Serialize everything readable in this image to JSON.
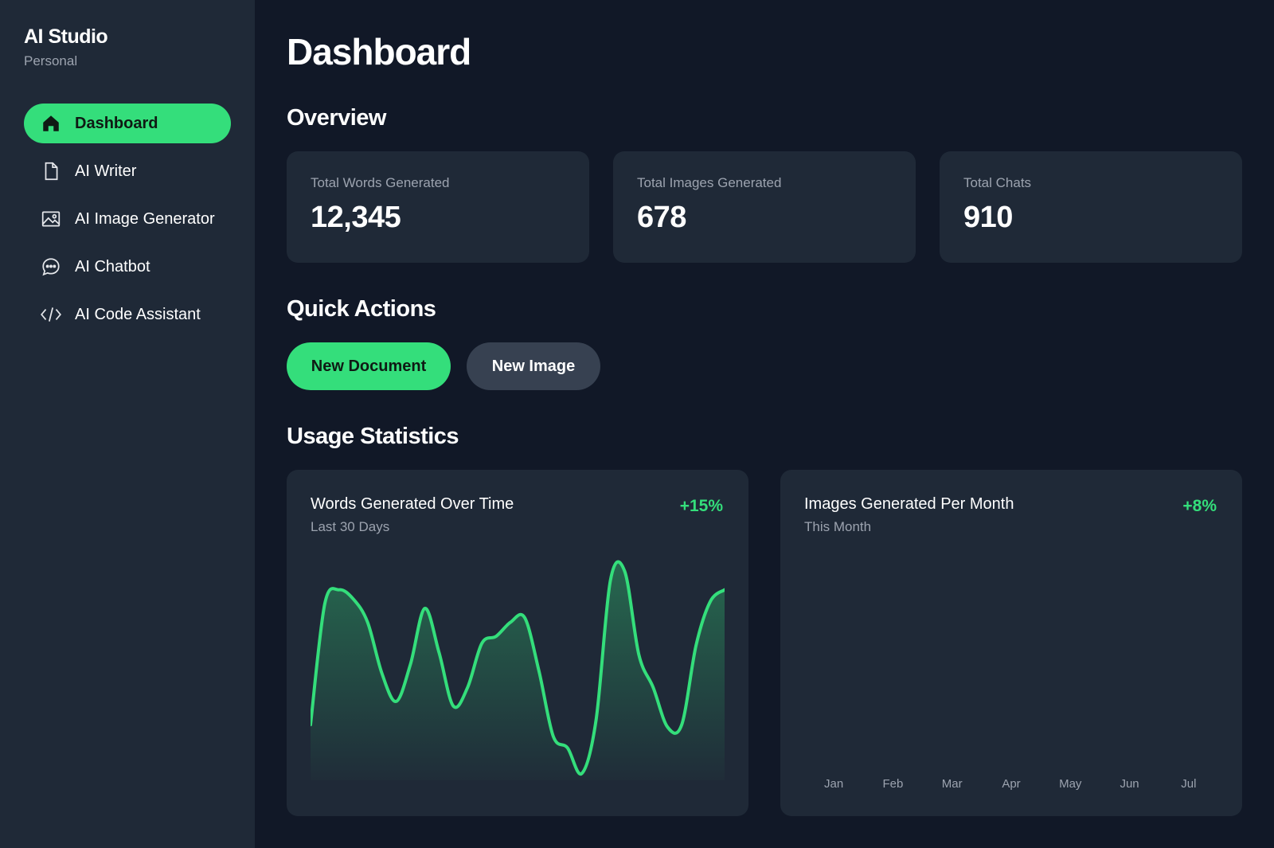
{
  "sidebar": {
    "brand_title": "AI Studio",
    "brand_sub": "Personal",
    "items": [
      {
        "label": "Dashboard",
        "icon": "home-icon",
        "active": true
      },
      {
        "label": "AI Writer",
        "icon": "document-icon",
        "active": false
      },
      {
        "label": "AI Image Generator",
        "icon": "image-icon",
        "active": false
      },
      {
        "label": "AI Chatbot",
        "icon": "chat-bubble-icon",
        "active": false
      },
      {
        "label": "AI Code Assistant",
        "icon": "code-icon",
        "active": false
      }
    ]
  },
  "main": {
    "title": "Dashboard",
    "overview": {
      "heading": "Overview",
      "cards": [
        {
          "label": "Total Words Generated",
          "value": "12,345"
        },
        {
          "label": "Total Images Generated",
          "value": "678"
        },
        {
          "label": "Total Chats",
          "value": "910"
        }
      ]
    },
    "quick_actions": {
      "heading": "Quick Actions",
      "primary_label": "New Document",
      "secondary_label": "New Image"
    },
    "usage": {
      "heading": "Usage Statistics",
      "words_chart": {
        "title": "Words Generated Over Time",
        "subtitle": "Last 30 Days",
        "change": "+15%"
      },
      "images_chart": {
        "title": "Images Generated Per Month",
        "subtitle": "This Month",
        "change": "+8%"
      }
    }
  },
  "colors": {
    "accent": "#34de7b",
    "background": "#111827",
    "panel": "#1f2937",
    "muted_text": "#9ca3af",
    "secondary_button": "#374151"
  },
  "chart_data": [
    {
      "type": "area",
      "title": "Words Generated Over Time",
      "subtitle": "Last 30 Days",
      "xlabel": "",
      "ylabel": "",
      "x": [
        1,
        2,
        3,
        4,
        5,
        6,
        7,
        8,
        9,
        10,
        11,
        12,
        13,
        14,
        15,
        16,
        17,
        18,
        19,
        20,
        21,
        22,
        23,
        24,
        25,
        26,
        27,
        28,
        29,
        30
      ],
      "values": [
        26,
        78,
        84,
        80,
        70,
        48,
        36,
        52,
        76,
        57,
        34,
        42,
        61,
        64,
        70,
        72,
        49,
        21,
        16,
        5,
        28,
        88,
        92,
        56,
        42,
        25,
        26,
        60,
        79,
        84
      ],
      "ylim": [
        0,
        100
      ],
      "grid": false,
      "legend": "none"
    },
    {
      "type": "bar",
      "title": "Images Generated Per Month",
      "subtitle": "This Month",
      "categories": [
        "Jan",
        "Feb",
        "Mar",
        "Apr",
        "May",
        "Jun",
        "Jul"
      ],
      "values": [],
      "grid": false,
      "legend": "none"
    }
  ]
}
